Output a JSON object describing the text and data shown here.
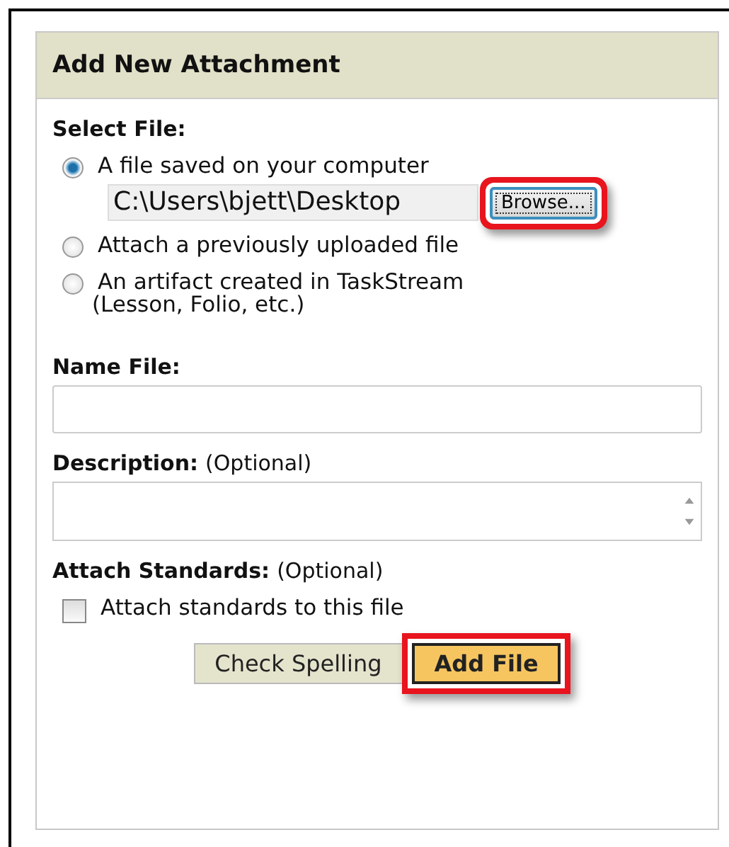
{
  "panel": {
    "title": "Add New Attachment"
  },
  "select_file": {
    "label": "Select File:",
    "options": [
      {
        "label": "A file saved on your computer",
        "selected": true
      },
      {
        "label": "Attach a previously uploaded file",
        "selected": false
      },
      {
        "label": "An artifact created in TaskStream",
        "note": "(Lesson, Folio, etc.)",
        "selected": false
      }
    ],
    "file_path": "C:\\Users\\bjett\\Desktop",
    "browse_button": {
      "label": "Browse...",
      "highlighted": true
    }
  },
  "name_file": {
    "label": "Name File:"
  },
  "description": {
    "label": "Description:",
    "hint": "(Optional)"
  },
  "attach_standards": {
    "label": "Attach Standards:",
    "hint": "(Optional)",
    "checkbox": {
      "label": "Attach standards to this file",
      "checked": false
    }
  },
  "buttons": [
    {
      "label": "Check Spelling",
      "kind": "secondary",
      "highlighted": false
    },
    {
      "label": "Add File",
      "kind": "primary",
      "highlighted": true
    }
  ]
}
